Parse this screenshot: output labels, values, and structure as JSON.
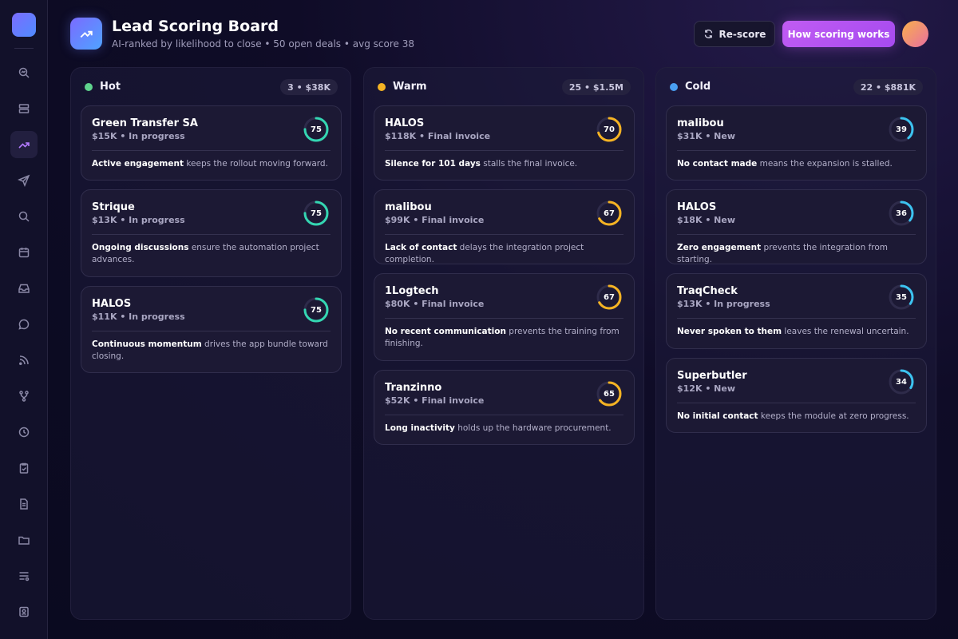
{
  "header": {
    "title": "Lead Scoring Board",
    "subtitle": "AI-ranked by likelihood to close • 50 open deals • avg score 38",
    "rescore_label": "Re-score",
    "how_label": "How scoring works"
  },
  "sidebar": {
    "items": [
      {
        "icon": "search-analytics-icon"
      },
      {
        "icon": "layers-icon"
      },
      {
        "icon": "trending-up-icon",
        "active": true
      },
      {
        "icon": "send-icon"
      },
      {
        "icon": "search-icon"
      },
      {
        "icon": "calendar-icon"
      },
      {
        "icon": "inbox-icon"
      },
      {
        "icon": "chat-icon"
      },
      {
        "icon": "rss-icon"
      },
      {
        "icon": "git-branch-icon"
      },
      {
        "icon": "clock-icon"
      },
      {
        "icon": "clipboard-check-icon"
      },
      {
        "icon": "document-icon"
      },
      {
        "icon": "folder-icon"
      },
      {
        "icon": "list-filter-icon"
      },
      {
        "icon": "badge-icon"
      }
    ]
  },
  "colors": {
    "hot": "#5fd38d",
    "warm": "#f5b323",
    "cold": "#4a9ff2",
    "ring_hot": "#34d6b2",
    "ring_warm": "#f5b323",
    "ring_cold": "#3cc3f0",
    "accent": "#b45cf0"
  },
  "columns": [
    {
      "name": "Hot",
      "badge": "3 • $38K",
      "cards": [
        {
          "name": "Green Transfer SA",
          "meta": "$15K • In progress",
          "score": "75",
          "score_value": 75,
          "note_bold": "Active engagement",
          "note": " keeps the rollout moving forward."
        },
        {
          "name": "Strique",
          "meta": "$13K • In progress",
          "score": "75",
          "score_value": 75,
          "note_bold": "Ongoing discussions",
          "note": " ensure the automation project advances."
        },
        {
          "name": "HALOS",
          "meta": "$11K • In progress",
          "score": "75",
          "score_value": 75,
          "note_bold": "Continuous momentum",
          "note": " drives the app bundle toward closing."
        }
      ]
    },
    {
      "name": "Warm",
      "badge": "25 • $1.5M",
      "cards": [
        {
          "name": "HALOS",
          "meta": "$118K • Final invoice",
          "score": "70",
          "score_value": 70,
          "note_bold": "Silence for 101 days",
          "note": " stalls the final invoice."
        },
        {
          "name": "malibou",
          "meta": "$99K • Final invoice",
          "score": "67",
          "score_value": 67,
          "note_bold": "Lack of contact",
          "note": " delays the integration project completion."
        },
        {
          "name": "1Logtech",
          "meta": "$80K • Final invoice",
          "score": "67",
          "score_value": 67,
          "note_bold": "No recent communication",
          "note": " prevents the training from finishing."
        },
        {
          "name": "Tranzinno",
          "meta": "$52K • Final invoice",
          "score": "65",
          "score_value": 65,
          "note_bold": "Long inactivity",
          "note": " holds up the hardware procurement."
        }
      ]
    },
    {
      "name": "Cold",
      "badge": "22 • $881K",
      "cards": [
        {
          "name": "malibou",
          "meta": "$31K • New",
          "score": "39",
          "score_value": 39,
          "note_bold": "No contact made",
          "note": " means the expansion is stalled."
        },
        {
          "name": "HALOS",
          "meta": "$18K • New",
          "score": "36",
          "score_value": 36,
          "note_bold": "Zero engagement",
          "note": " prevents the integration from starting."
        },
        {
          "name": "TraqCheck",
          "meta": "$13K • In progress",
          "score": "35",
          "score_value": 35,
          "note_bold": "Never spoken to them",
          "note": " leaves the renewal uncertain."
        },
        {
          "name": "Superbutler",
          "meta": "$12K • New",
          "score": "34",
          "score_value": 34,
          "note_bold": "No initial contact",
          "note": " keeps the module at zero progress."
        }
      ]
    }
  ]
}
